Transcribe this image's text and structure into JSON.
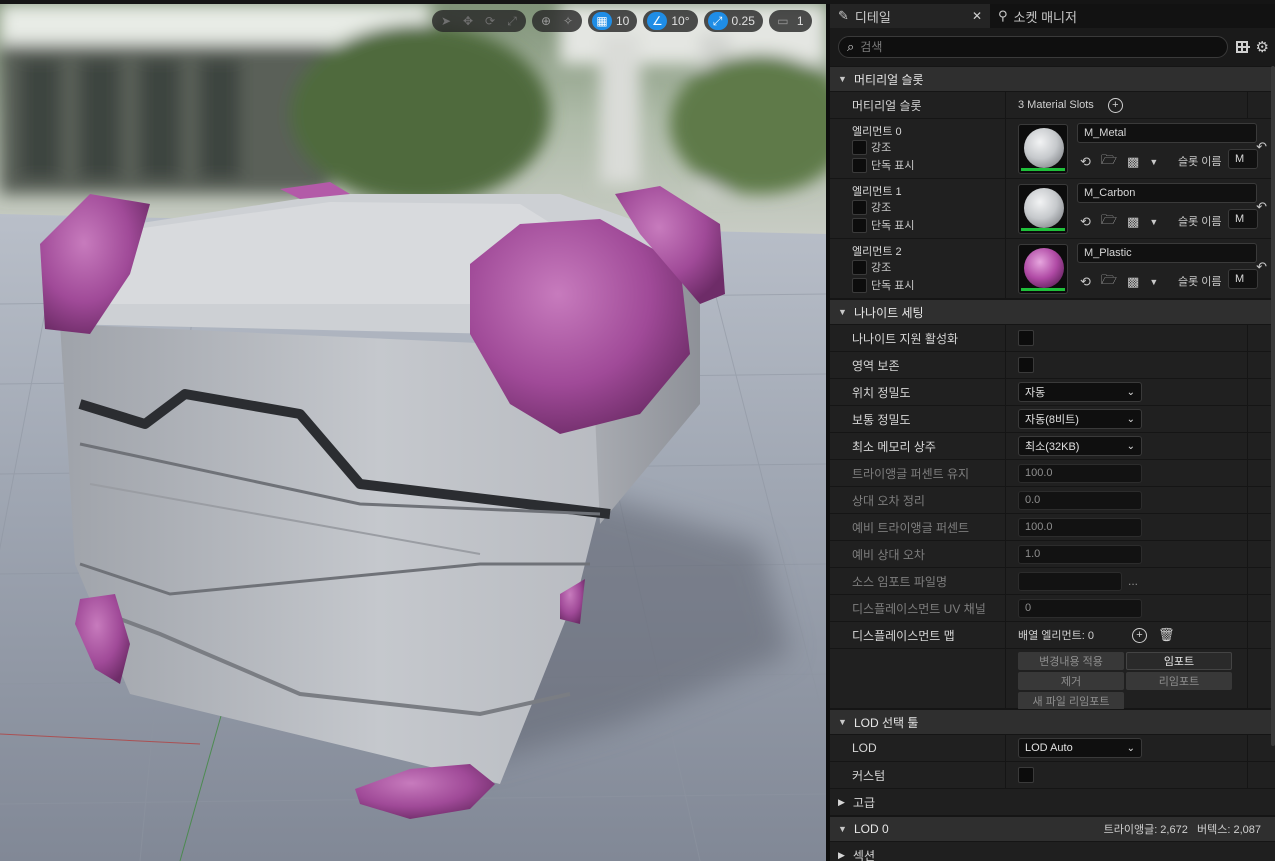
{
  "toolbar": {
    "grid_snap": "10",
    "rotation_snap": "10°",
    "scale_snap": "0.25",
    "camera_speed": "1"
  },
  "tabs": [
    {
      "label": "디테일",
      "active": true
    },
    {
      "label": "소켓 매니저",
      "active": false
    }
  ],
  "search": {
    "placeholder": "검색"
  },
  "material_section": {
    "title": "머티리얼 슬롯",
    "slots_label": "머티리얼 슬롯",
    "slots_value": "3 Material Slots",
    "elements": [
      {
        "label": "엘리먼트 0",
        "highlight": "강조",
        "isolate": "단독 표시",
        "material": "M_Metal",
        "slot_label": "슬롯 이름",
        "slot_value": "M",
        "color": "#c9ccd0"
      },
      {
        "label": "엘리먼트 1",
        "highlight": "강조",
        "isolate": "단독 표시",
        "material": "M_Carbon",
        "slot_label": "슬롯 이름",
        "slot_value": "M",
        "color": "#c9ccd0"
      },
      {
        "label": "엘리먼트 2",
        "highlight": "강조",
        "isolate": "단독 표시",
        "material": "M_Plastic",
        "slot_label": "슬롯 이름",
        "slot_value": "M",
        "color": "#b04aa5"
      }
    ]
  },
  "nanite_section": {
    "title": "나나이트 세팅",
    "enable": "나나이트 지원 활성화",
    "preserve_area": "영역 보존",
    "position_precision": {
      "label": "위치 정밀도",
      "value": "자동"
    },
    "normal_precision": {
      "label": "보통 정밀도",
      "value": "자동(8비트)"
    },
    "min_resident": {
      "label": "최소 메모리 상주",
      "value": "최소(32KB)"
    },
    "keep_percent": {
      "label": "트라이앵글 퍼센트 유지",
      "value": "100.0"
    },
    "trim_relative_error": {
      "label": "상대 오차 정리",
      "value": "0.0"
    },
    "fallback_percent": {
      "label": "예비 트라이앵글 퍼센트",
      "value": "100.0"
    },
    "fallback_error": {
      "label": "예비 상대 오차",
      "value": "1.0"
    },
    "source_import_file": {
      "label": "소스 임포트 파일명",
      "value": "",
      "more": "..."
    },
    "displacement_uv": {
      "label": "디스플레이스먼트 UV 채널",
      "value": "0"
    },
    "displacement_maps": {
      "label": "디스플레이스먼트 맵",
      "value": "배열 엘리먼트: 0"
    },
    "buttons": {
      "apply": "변경내용 적용",
      "import": "임포트",
      "remove": "제거",
      "reimport": "리임포트",
      "reimport_new": "새 파일 리임포트"
    }
  },
  "lod_picker": {
    "title": "LOD 선택 툴",
    "lod_label": "LOD",
    "lod_value": "LOD Auto",
    "custom_label": "커스텀"
  },
  "advanced": {
    "title": "고급"
  },
  "lod0": {
    "title": "LOD 0",
    "stats": "트라이앵글: 2,672   버텍스: 2,087"
  },
  "sections": {
    "title": "섹션"
  }
}
